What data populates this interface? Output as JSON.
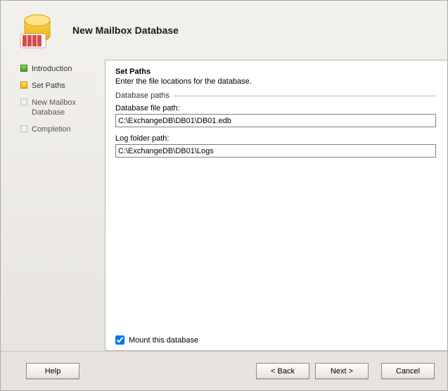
{
  "header": {
    "title": "New Mailbox Database"
  },
  "sidebar": {
    "steps": [
      {
        "label": "Introduction",
        "state": "done"
      },
      {
        "label": "Set Paths",
        "state": "current"
      },
      {
        "label": "New Mailbox Database",
        "state": "pending"
      },
      {
        "label": "Completion",
        "state": "pending"
      }
    ]
  },
  "main": {
    "heading": "Set Paths",
    "description": "Enter the file locations for the database.",
    "group": "Database paths",
    "db_file_label": "Database file path:",
    "db_file_value": "C:\\ExchangeDB\\DB01\\DB01.edb",
    "log_folder_label": "Log folder path:",
    "log_folder_value": "C:\\ExchangeDB\\DB01\\Logs",
    "mount_label": "Mount this database",
    "mount_checked": true
  },
  "footer": {
    "help": "Help",
    "back": "< Back",
    "next": "Next >",
    "cancel": "Cancel"
  }
}
